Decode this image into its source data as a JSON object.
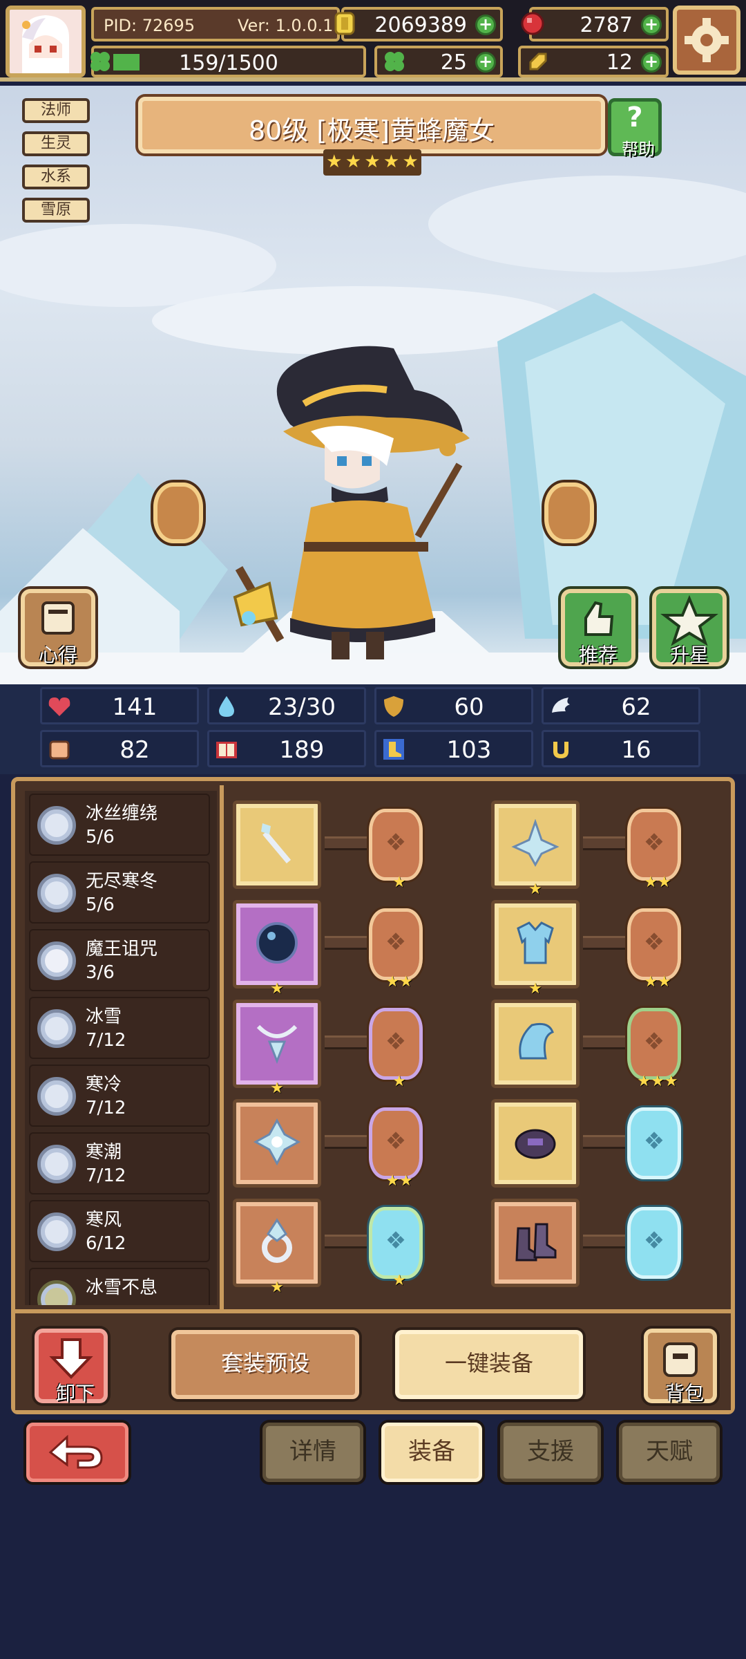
{
  "header": {
    "pid": "PID: 72695",
    "version": "Ver: 1.0.0.1",
    "gold": "2069389",
    "gems": "2787",
    "clover": "25",
    "ticket": "12",
    "exp_text": "159/1500",
    "exp_fraction": 0.106
  },
  "character": {
    "title": "80级 [极寒]黄蜂魔女",
    "star_count": 5,
    "tags": [
      "法师",
      "生灵",
      "水系",
      "雪原"
    ],
    "help_label": "帮助",
    "notes_label": "心得",
    "recommend_label": "推荐",
    "starup_label": "升星"
  },
  "stats": {
    "hp": "141",
    "mp": "23/30",
    "defense": "60",
    "speed": "62",
    "attack": "82",
    "magic": "189",
    "agility": "103",
    "luck": "16"
  },
  "sets": [
    {
      "name": "冰丝缠绕",
      "count": "5/6"
    },
    {
      "name": "无尽寒冬",
      "count": "5/6"
    },
    {
      "name": "魔王诅咒",
      "count": "3/6"
    },
    {
      "name": "冰雪",
      "count": "7/12"
    },
    {
      "name": "寒冷",
      "count": "7/12"
    },
    {
      "name": "寒潮",
      "count": "7/12"
    },
    {
      "name": "寒风",
      "count": "6/12"
    },
    {
      "name": "冰雪不息",
      "count": ""
    }
  ],
  "equipment": [
    {
      "slot": "wand",
      "frame": "gold",
      "stars": "★",
      "rune": "or",
      "rune_stars": "★"
    },
    {
      "slot": "crown",
      "frame": "gold",
      "stars": "★",
      "rune": "or",
      "rune_stars": "★★"
    },
    {
      "slot": "orb",
      "frame": "purple",
      "stars": "★",
      "rune": "or",
      "rune_stars": "★★"
    },
    {
      "slot": "armor",
      "frame": "gold",
      "stars": "★",
      "rune": "or",
      "rune_stars": "★★"
    },
    {
      "slot": "necklace",
      "frame": "purple",
      "stars": "★",
      "rune": "pu",
      "rune_stars": "★"
    },
    {
      "slot": "cape",
      "frame": "gold",
      "stars": "",
      "rune": "gr",
      "rune_stars": "★★★"
    },
    {
      "slot": "crystal",
      "frame": "copper",
      "stars": "",
      "rune": "pu",
      "rune_stars": "★★"
    },
    {
      "slot": "gauntlet",
      "frame": "gold",
      "stars": "",
      "rune": "bl",
      "rune_stars": ""
    },
    {
      "slot": "ring",
      "frame": "copper",
      "stars": "★",
      "rune": "blg",
      "rune_stars": "★"
    },
    {
      "slot": "boots",
      "frame": "copper",
      "stars": "",
      "rune": "bl",
      "rune_stars": ""
    }
  ],
  "actions": {
    "unequip": "卸下",
    "preset": "套装预设",
    "auto_equip": "一键装备",
    "backpack": "背包"
  },
  "nav": {
    "details": "详情",
    "equip": "装备",
    "support": "支援",
    "talent": "天赋"
  },
  "colors": {
    "accent_gold": "#c89a5c",
    "bg_navy": "#1b2140",
    "green": "#52b34a",
    "red": "#d6514a"
  }
}
